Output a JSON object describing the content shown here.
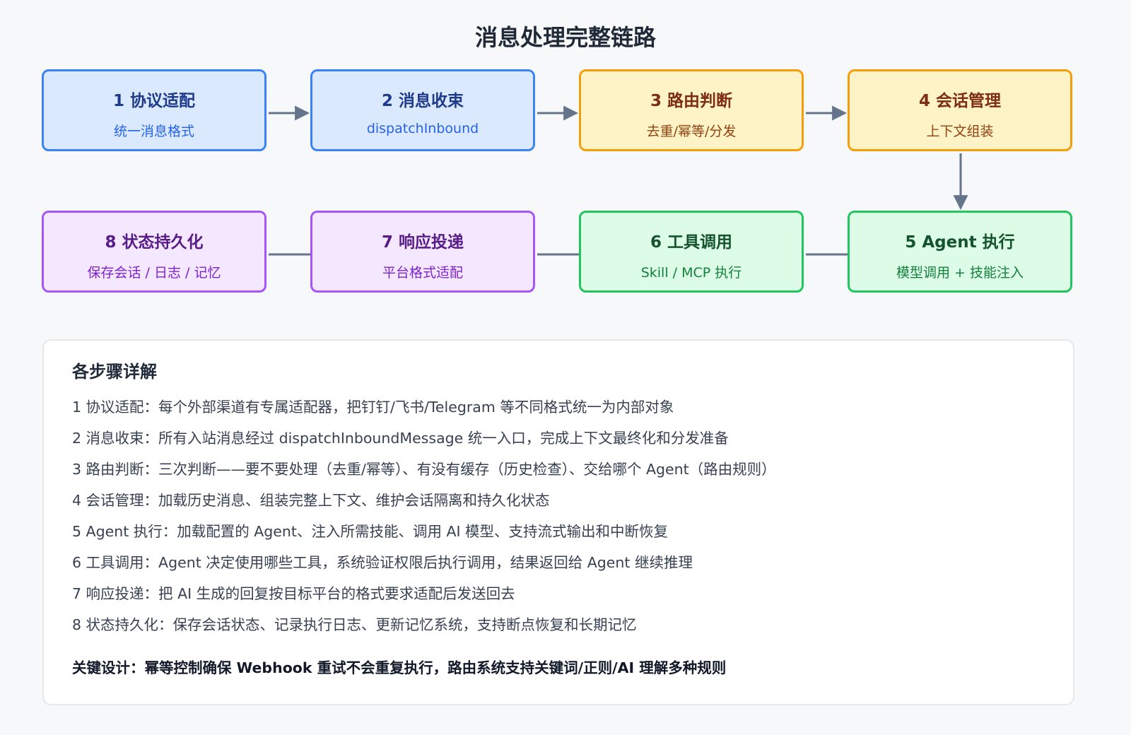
{
  "title": "消息处理完整链路",
  "steps": [
    {
      "title": "1 协议适配",
      "subtitle": "统一消息格式"
    },
    {
      "title": "2 消息收束",
      "subtitle": "dispatchInbound"
    },
    {
      "title": "3 路由判断",
      "subtitle": "去重/幂等/分发"
    },
    {
      "title": "4 会话管理",
      "subtitle": "上下文组装"
    },
    {
      "title": "5 Agent 执行",
      "subtitle": "模型调用 + 技能注入"
    },
    {
      "title": "6 工具调用",
      "subtitle": "Skill / MCP 执行"
    },
    {
      "title": "7 响应投递",
      "subtitle": "平台格式适配"
    },
    {
      "title": "8 状态持久化",
      "subtitle": "保存会话 / 日志 / 记忆"
    }
  ],
  "details": {
    "heading": "各步骤详解",
    "items": [
      "1 协议适配：每个外部渠道有专属适配器，把钉钉/飞书/Telegram 等不同格式统一为内部对象",
      "2 消息收束：所有入站消息经过 dispatchInboundMessage 统一入口，完成上下文最终化和分发准备",
      "3 路由判断：三次判断——要不要处理（去重/幂等）、有没有缓存（历史检查）、交给哪个 Agent（路由规则）",
      "4 会话管理：加载历史消息、组装完整上下文、维护会话隔离和持久化状态",
      "5 Agent 执行：加载配置的 Agent、注入所需技能、调用 AI 模型、支持流式输出和中断恢复",
      "6 工具调用：Agent 决定使用哪些工具，系统验证权限后执行调用，结果返回给 Agent 继续推理",
      "7 响应投递：把 AI 生成的回复按目标平台的格式要求适配后发送回去",
      "8 状态持久化：保存会话状态、记录执行日志、更新记忆系统，支持断点恢复和长期记忆"
    ],
    "key_design": "关键设计：幂等控制确保 Webhook 重试不会重复执行，路由系统支持关键词/正则/AI 理解多种规则"
  },
  "colors": {
    "blue": "#3b82f6",
    "amber": "#f59e0b",
    "green": "#22c55e",
    "purple": "#a855f7",
    "connector": "#64748b"
  }
}
